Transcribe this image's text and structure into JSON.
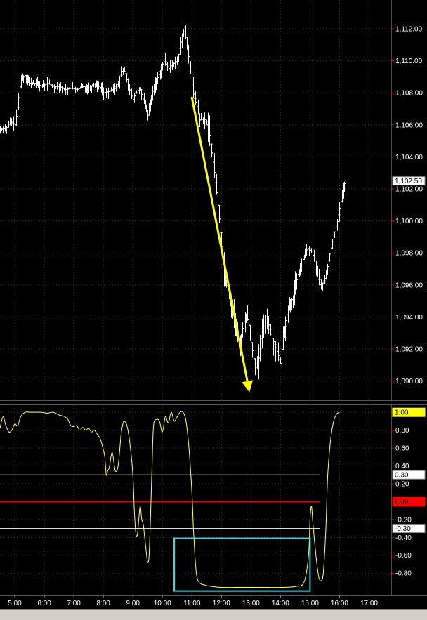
{
  "colors": {
    "background": "#000000",
    "grid": "#3a3a3a",
    "price_bars": "#ffffff",
    "arrow": "#ffff00",
    "oscillator": "#ffff66",
    "level_white": "#ffffff",
    "level_red": "#ff0000",
    "box": "#40d8e0",
    "axis_border": "#ff0000",
    "tag_yellow": "#ffff00",
    "tag_red": "#ff0000"
  },
  "chart_data": [
    {
      "type": "bar",
      "subtype": "ohlc-intraday",
      "x_ticks": [
        "5:00",
        "6:00",
        "7:00",
        "8:00",
        "9:00",
        "10:00",
        "11:00",
        "12:00",
        "13:00",
        "14:00",
        "15:00",
        "16:00",
        "17:00"
      ],
      "x_range_hours": [
        4.5,
        17.75
      ],
      "ylim": [
        1088.8,
        1113.8
      ],
      "y_ticks": [
        "1,090.00",
        "1,092.00",
        "1,094.00",
        "1,096.00",
        "1,098.00",
        "1,100.00",
        "1,102.00",
        "1,104.00",
        "1,106.00",
        "1,108.00",
        "1,110.00",
        "1,112.00"
      ],
      "y_tick_values": [
        1090,
        1092,
        1094,
        1096,
        1098,
        1100,
        1102,
        1104,
        1106,
        1108,
        1110,
        1112
      ],
      "last_price_label": "1,102.50",
      "last_price": 1102.5,
      "grid": true,
      "price_path": [
        [
          4.5,
          1105.7
        ],
        [
          4.7,
          1105.8
        ],
        [
          4.85,
          1106.2
        ],
        [
          5.0,
          1106.0
        ],
        [
          5.1,
          1107.3
        ],
        [
          5.2,
          1108.9
        ],
        [
          5.35,
          1109.1
        ],
        [
          5.5,
          1108.6
        ],
        [
          5.7,
          1108.6
        ],
        [
          5.9,
          1108.4
        ],
        [
          6.1,
          1108.6
        ],
        [
          6.3,
          1108.4
        ],
        [
          6.5,
          1108.4
        ],
        [
          6.7,
          1108.2
        ],
        [
          6.9,
          1108.3
        ],
        [
          7.1,
          1108.2
        ],
        [
          7.3,
          1108.4
        ],
        [
          7.5,
          1108.3
        ],
        [
          7.7,
          1108.6
        ],
        [
          7.9,
          1108.3
        ],
        [
          8.0,
          1108.0
        ],
        [
          8.2,
          1108.1
        ],
        [
          8.4,
          1108.3
        ],
        [
          8.55,
          1108.9
        ],
        [
          8.65,
          1109.5
        ],
        [
          8.75,
          1109.2
        ],
        [
          8.85,
          1108.3
        ],
        [
          9.0,
          1107.6
        ],
        [
          9.1,
          1108.1
        ],
        [
          9.25,
          1108.2
        ],
        [
          9.35,
          1107.5
        ],
        [
          9.5,
          1106.6
        ],
        [
          9.6,
          1107.5
        ],
        [
          9.7,
          1108.4
        ],
        [
          9.8,
          1108.8
        ],
        [
          9.95,
          1109.5
        ],
        [
          10.05,
          1110.1
        ],
        [
          10.2,
          1109.5
        ],
        [
          10.35,
          1109.8
        ],
        [
          10.5,
          1110.0
        ],
        [
          10.65,
          1111.4
        ],
        [
          10.75,
          1112.1
        ],
        [
          10.85,
          1110.6
        ],
        [
          10.95,
          1109.3
        ],
        [
          11.05,
          1107.8
        ],
        [
          11.15,
          1107.3
        ],
        [
          11.25,
          1106.3
        ],
        [
          11.4,
          1106.4
        ],
        [
          11.55,
          1105.8
        ],
        [
          11.7,
          1103.8
        ],
        [
          11.85,
          1101.5
        ],
        [
          12.0,
          1098.4
        ],
        [
          12.1,
          1096.4
        ],
        [
          12.25,
          1095.4
        ],
        [
          12.4,
          1094.1
        ],
        [
          12.5,
          1093.0
        ],
        [
          12.6,
          1092.2
        ],
        [
          12.7,
          1093.2
        ],
        [
          12.8,
          1094.2
        ],
        [
          12.9,
          1093.7
        ],
        [
          13.0,
          1092.4
        ],
        [
          13.1,
          1091.2
        ],
        [
          13.2,
          1090.7
        ],
        [
          13.35,
          1092.9
        ],
        [
          13.5,
          1094.0
        ],
        [
          13.6,
          1093.4
        ],
        [
          13.7,
          1092.7
        ],
        [
          13.85,
          1092.0
        ],
        [
          14.0,
          1091.1
        ],
        [
          14.1,
          1093.2
        ],
        [
          14.25,
          1094.5
        ],
        [
          14.4,
          1095.2
        ],
        [
          14.5,
          1096.0
        ],
        [
          14.6,
          1096.8
        ],
        [
          14.75,
          1097.6
        ],
        [
          14.9,
          1098.3
        ],
        [
          15.05,
          1098.1
        ],
        [
          15.2,
          1097.0
        ],
        [
          15.35,
          1095.9
        ],
        [
          15.5,
          1096.4
        ],
        [
          15.6,
          1097.3
        ],
        [
          15.75,
          1098.7
        ],
        [
          15.9,
          1099.8
        ],
        [
          16.0,
          1100.8
        ],
        [
          16.1,
          1101.8
        ],
        [
          16.2,
          1102.6
        ]
      ],
      "annotation": {
        "type": "arrow",
        "from": [
          11.0,
          1107.7
        ],
        "to": [
          12.95,
          1089.3
        ]
      }
    },
    {
      "type": "line",
      "subtype": "oscillator",
      "ylim": [
        -1.05,
        1.08
      ],
      "y_ticks": [
        "1.00",
        "0.80",
        "0.60",
        "0.40",
        "0.20",
        "-0.20",
        "-0.40",
        "-0.60",
        "-0.80"
      ],
      "y_tick_values": [
        1.0,
        0.8,
        0.6,
        0.4,
        0.2,
        -0.2,
        -0.4,
        -0.6,
        -0.8
      ],
      "reference_lines": [
        {
          "value": 0.3,
          "label": "0.30",
          "color": "white"
        },
        {
          "value": 0.0,
          "label": "0.00",
          "color": "red"
        },
        {
          "value": -0.3,
          "label": "-0.30",
          "color": "white"
        }
      ],
      "current_value_label": "1.00",
      "current_value": 1.0,
      "series": [
        {
          "x": [
            4.5,
            4.6,
            4.7,
            4.8,
            4.9,
            5.0,
            5.1,
            5.2,
            5.35,
            5.5,
            5.7,
            5.9,
            6.1,
            6.3,
            6.5,
            6.7,
            6.8,
            6.9,
            7.0,
            7.1,
            7.2,
            7.3,
            7.4,
            7.5,
            7.6,
            7.7,
            7.8,
            7.9,
            8.0,
            8.05,
            8.1,
            8.15,
            8.2,
            8.3,
            8.4,
            8.5,
            8.6,
            8.65,
            8.7,
            8.8,
            8.9,
            9.0,
            9.05,
            9.1,
            9.15,
            9.2,
            9.25,
            9.3,
            9.35,
            9.4,
            9.45,
            9.5,
            9.55,
            9.6,
            9.65,
            9.7,
            9.8,
            9.9,
            10.0,
            10.1,
            10.2,
            10.3,
            10.4,
            10.5,
            10.6,
            10.7,
            10.8,
            10.9,
            11.0,
            11.05,
            11.1,
            11.15,
            11.2,
            11.3,
            11.4,
            11.5,
            11.7,
            12.0,
            12.5,
            13.0,
            13.5,
            14.0,
            14.5,
            14.8,
            14.95,
            15.0,
            15.05,
            15.1,
            15.2,
            15.3,
            15.4,
            15.45,
            15.5,
            15.55,
            15.6,
            15.7,
            15.8,
            15.9,
            16.0
          ],
          "y": [
            0.82,
            0.95,
            0.85,
            0.78,
            0.8,
            0.87,
            0.85,
            0.95,
            1.0,
            1.0,
            1.0,
            1.0,
            0.99,
            1.0,
            0.97,
            0.95,
            0.92,
            0.85,
            0.84,
            0.85,
            0.8,
            0.83,
            0.8,
            0.82,
            0.78,
            0.8,
            0.75,
            0.7,
            0.58,
            0.5,
            0.3,
            0.35,
            0.38,
            0.55,
            0.35,
            0.4,
            0.75,
            0.85,
            0.9,
            0.85,
            0.65,
            0.3,
            -0.1,
            -0.35,
            -0.38,
            -0.2,
            -0.05,
            -0.2,
            -0.25,
            -0.4,
            -0.55,
            -0.68,
            -0.6,
            -0.15,
            0.4,
            0.85,
            0.92,
            0.9,
            0.78,
            0.95,
            0.88,
            1.0,
            0.9,
            0.95,
            1.0,
            1.0,
            0.9,
            0.6,
            0.1,
            -0.3,
            -0.6,
            -0.8,
            -0.88,
            -0.92,
            -0.93,
            -0.94,
            -0.95,
            -0.96,
            -0.96,
            -0.96,
            -0.96,
            -0.96,
            -0.95,
            -0.9,
            -0.6,
            -0.2,
            -0.05,
            -0.25,
            -0.6,
            -0.85,
            -0.88,
            -0.8,
            -0.55,
            -0.2,
            0.3,
            0.7,
            0.9,
            0.98,
            1.0
          ]
        }
      ],
      "annotation": {
        "type": "rectangle",
        "x": [
          10.4,
          15.0
        ],
        "y": [
          -0.41,
          -1.0
        ]
      }
    }
  ]
}
